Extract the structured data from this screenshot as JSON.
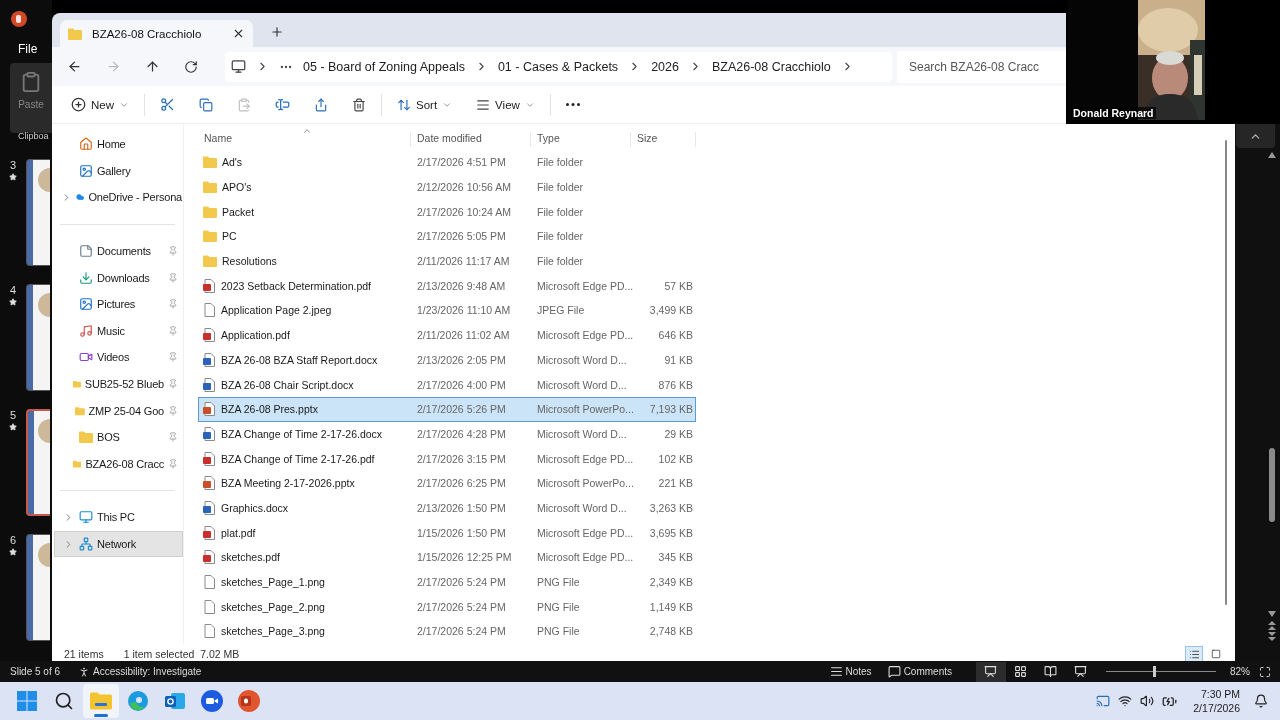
{
  "powerpoint": {
    "file_menu": "File",
    "paste": "Paste",
    "clipboard": "Clipboa",
    "slides": [
      {
        "number": "3",
        "selected": false
      },
      {
        "number": "4",
        "selected": false
      },
      {
        "number": "5",
        "selected": true
      },
      {
        "number": "6",
        "selected": false
      }
    ]
  },
  "explorer": {
    "tab": {
      "title": "BZA26-08 Cracchiolo",
      "selected": true
    },
    "breadcrumb": [
      "05 - Board of Zoning Appeals",
      "01 - Cases & Packets",
      "2026",
      "BZA26-08 Cracchiolo"
    ],
    "search": {
      "placeholder": "Search BZA26-08 Cracc"
    },
    "toolbar": {
      "new": "New",
      "sort": "Sort",
      "view": "View"
    },
    "sidebar": [
      [
        {
          "kind": "home",
          "label": "Home",
          "expandable": false,
          "pinned": false,
          "selected": false
        },
        {
          "kind": "gallery",
          "label": "Gallery",
          "expandable": false,
          "pinned": false,
          "selected": false
        },
        {
          "kind": "onedrive",
          "label": "OneDrive - Persona",
          "expandable": true,
          "pinned": false,
          "selected": false
        }
      ],
      [
        {
          "kind": "documents",
          "label": "Documents",
          "expandable": false,
          "pinned": true,
          "selected": false
        },
        {
          "kind": "downloads",
          "label": "Downloads",
          "expandable": false,
          "pinned": true,
          "selected": false
        },
        {
          "kind": "pictures",
          "label": "Pictures",
          "expandable": false,
          "pinned": true,
          "selected": false
        },
        {
          "kind": "music",
          "label": "Music",
          "expandable": false,
          "pinned": true,
          "selected": false
        },
        {
          "kind": "videos",
          "label": "Videos",
          "expandable": false,
          "pinned": true,
          "selected": false
        },
        {
          "kind": "folder",
          "label": "SUB25-52 Blueb",
          "expandable": false,
          "pinned": true,
          "selected": false
        },
        {
          "kind": "folder",
          "label": "ZMP 25-04 Goo",
          "expandable": false,
          "pinned": true,
          "selected": false
        },
        {
          "kind": "folder",
          "label": "BOS",
          "expandable": false,
          "pinned": true,
          "selected": false
        },
        {
          "kind": "folder",
          "label": "BZA26-08 Cracc",
          "expandable": false,
          "pinned": true,
          "selected": false
        }
      ],
      [
        {
          "kind": "pc",
          "label": "This PC",
          "expandable": true,
          "pinned": false,
          "selected": false
        },
        {
          "kind": "network",
          "label": "Network",
          "expandable": true,
          "pinned": false,
          "selected": true
        }
      ]
    ],
    "columns": [
      "Name",
      "Date modified",
      "Type",
      "Size"
    ],
    "files": [
      {
        "kind": "folder",
        "name": "Ad's",
        "date": "2/17/2026 4:51 PM",
        "type": "File folder",
        "selected": false
      },
      {
        "kind": "folder",
        "name": "APO's",
        "date": "2/12/2026 10:56 AM",
        "type": "File folder",
        "selected": false
      },
      {
        "kind": "folder",
        "name": "Packet",
        "date": "2/17/2026 10:24 AM",
        "type": "File folder",
        "selected": false
      },
      {
        "kind": "folder",
        "name": "PC",
        "date": "2/17/2026 5:05 PM",
        "type": "File folder",
        "selected": false
      },
      {
        "kind": "folder",
        "name": "Resolutions",
        "date": "2/11/2026 11:17 AM",
        "type": "File folder",
        "selected": false
      },
      {
        "kind": "pdf",
        "name": "2023 Setback Determination.pdf",
        "date": "2/13/2026 9:48 AM",
        "type": "Microsoft Edge PD...",
        "size": "57 KB",
        "selected": false
      },
      {
        "name": "Application Page 2.jpeg",
        "date": "1/23/2026 11:10 AM",
        "type": "JPEG File",
        "size": "3,499 KB",
        "selected": false
      },
      {
        "kind": "pdf",
        "name": "Application.pdf",
        "date": "2/11/2026 11:02 AM",
        "type": "Microsoft Edge PD...",
        "size": "646 KB",
        "selected": false
      },
      {
        "kind": "word",
        "name": "BZA 26-08 BZA Staff Report.docx",
        "date": "2/13/2026 2:05 PM",
        "type": "Microsoft Word D...",
        "size": "91 KB",
        "selected": false
      },
      {
        "kind": "word",
        "name": "BZA 26-08 Chair Script.docx",
        "date": "2/17/2026 4:00 PM",
        "type": "Microsoft Word D...",
        "size": "876 KB",
        "selected": false
      },
      {
        "kind": "powerpoint",
        "name": "BZA 26-08 Pres.pptx",
        "date": "2/17/2026 5:26 PM",
        "type": "Microsoft PowerPo...",
        "size": "7,193 KB",
        "selected": true
      },
      {
        "kind": "word",
        "name": "BZA Change of Time 2-17-26.docx",
        "date": "2/17/2026 4:28 PM",
        "type": "Microsoft Word D...",
        "size": "29 KB",
        "selected": false
      },
      {
        "kind": "pdf",
        "name": "BZA Change of Time 2-17-26.pdf",
        "date": "2/17/2026 3:15 PM",
        "type": "Microsoft Edge PD...",
        "size": "102 KB",
        "selected": false
      },
      {
        "kind": "powerpoint",
        "name": "BZA Meeting 2-17-2026.pptx",
        "date": "2/17/2026 6:25 PM",
        "type": "Microsoft PowerPo...",
        "size": "221 KB",
        "selected": false
      },
      {
        "kind": "word",
        "name": "Graphics.docx",
        "date": "2/13/2026 1:50 PM",
        "type": "Microsoft Word D...",
        "size": "3,263 KB",
        "selected": false
      },
      {
        "kind": "pdf",
        "name": "plat.pdf",
        "date": "1/15/2026 1:50 PM",
        "type": "Microsoft Edge PD...",
        "size": "3,695 KB",
        "selected": false
      },
      {
        "kind": "pdf",
        "name": "sketches.pdf",
        "date": "1/15/2026 12:25 PM",
        "type": "Microsoft Edge PD...",
        "size": "345 KB",
        "selected": false
      },
      {
        "name": "sketches_Page_1.png",
        "date": "2/17/2026 5:24 PM",
        "type": "PNG File",
        "size": "2,349 KB",
        "selected": false
      },
      {
        "name": "sketches_Page_2.png",
        "date": "2/17/2026 5:24 PM",
        "type": "PNG File",
        "size": "1,149 KB",
        "selected": false
      },
      {
        "name": "sketches_Page_3.png",
        "date": "2/17/2026 5:24 PM",
        "type": "PNG File",
        "size": "2,748 KB",
        "selected": false
      }
    ],
    "status": {
      "count": "21 items",
      "selection": "1 item selected",
      "selection_size": "7.02 MB"
    }
  },
  "video": {
    "name": "Donald Reynard"
  },
  "ppt_status": {
    "slide": "Slide 5 of 6",
    "accessibility": "Accessibility: Investigate",
    "notes": "Notes",
    "comments": "Comments",
    "zoom_slider": {
      "level": 0.45
    },
    "zoom": "82%"
  },
  "taskbar": {
    "apps": [
      {
        "kind": "start",
        "selected": false
      },
      {
        "kind": "search",
        "selected": false
      },
      {
        "kind": "explorer",
        "selected": true
      },
      {
        "kind": "edge",
        "selected": false
      },
      {
        "kind": "outlook",
        "selected": false
      },
      {
        "kind": "zoom",
        "selected": false
      },
      {
        "kind": "powerpoint",
        "selected": false
      }
    ],
    "time": "7:30 PM",
    "date": "2/17/2026"
  }
}
